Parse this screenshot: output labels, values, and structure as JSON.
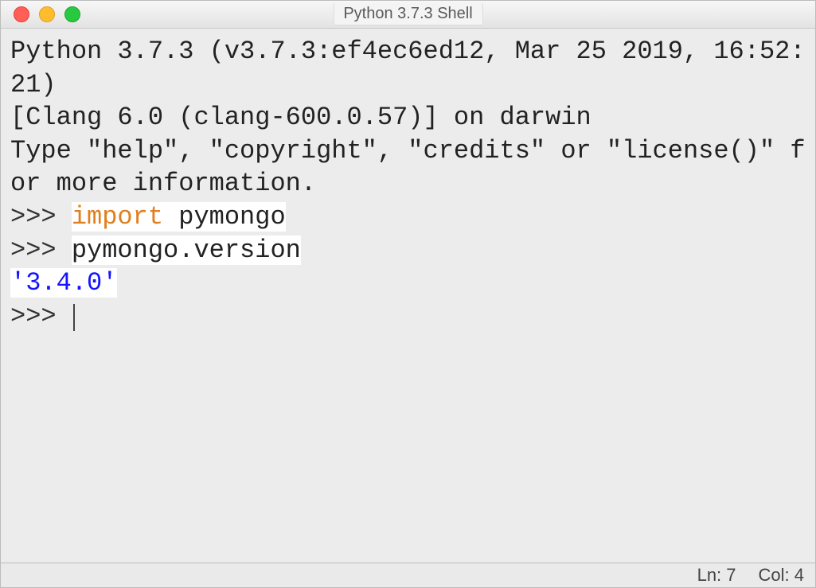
{
  "window": {
    "title": "Python 3.7.3 Shell"
  },
  "shell": {
    "banner_line1": "Python 3.7.3 (v3.7.3:ef4ec6ed12, Mar 25 2019, 16:52:21) ",
    "banner_line2": "[Clang 6.0 (clang-600.0.57)] on darwin",
    "banner_line3": "Type \"help\", \"copyright\", \"credits\" or \"license()\" for more information.",
    "prompt": ">>> ",
    "import_kw": "import",
    "space": " ",
    "import_module": "pymongo",
    "stmt2": "pymongo.version",
    "result": "'3.4.0'"
  },
  "status": {
    "ln_label": "Ln: 7",
    "col_label": "Col: 4"
  }
}
